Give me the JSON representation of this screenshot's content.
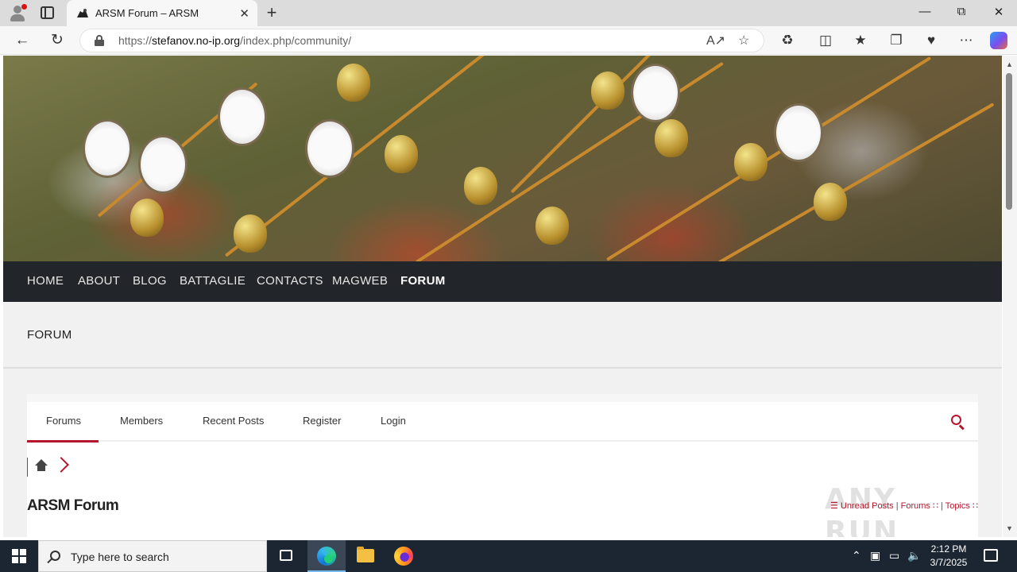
{
  "browser": {
    "tab_title": "ARSM Forum – ARSM",
    "url_prefix": "https://",
    "url_domain": "stefanov.no-ip.org",
    "url_path": "/index.php/community/",
    "new_tab": "+",
    "tab_close": "✕"
  },
  "site": {
    "nav": [
      "HOME",
      "ABOUT",
      "BLOG",
      "BATTAGLIE",
      "CONTACTS",
      "MAGWEB",
      "FORUM"
    ],
    "active_nav": "FORUM",
    "page_title": "FORUM"
  },
  "forum": {
    "tabs": [
      "Forums",
      "Members",
      "Recent Posts",
      "Register",
      "Login"
    ],
    "active_tab": "Forums",
    "title": "ARSM Forum",
    "links": {
      "unread": "Unread Posts",
      "forums": "Forums",
      "topics": "Topics",
      "separator": "|"
    },
    "watermark": "ANY RUN"
  },
  "taskbar": {
    "search_placeholder": "Type here to search",
    "time": "2:12 PM",
    "date": "3/7/2025"
  },
  "colors": {
    "accent": "#b4172d",
    "site_nav_bg": "#22262a",
    "taskbar_bg": "#1c2633"
  }
}
